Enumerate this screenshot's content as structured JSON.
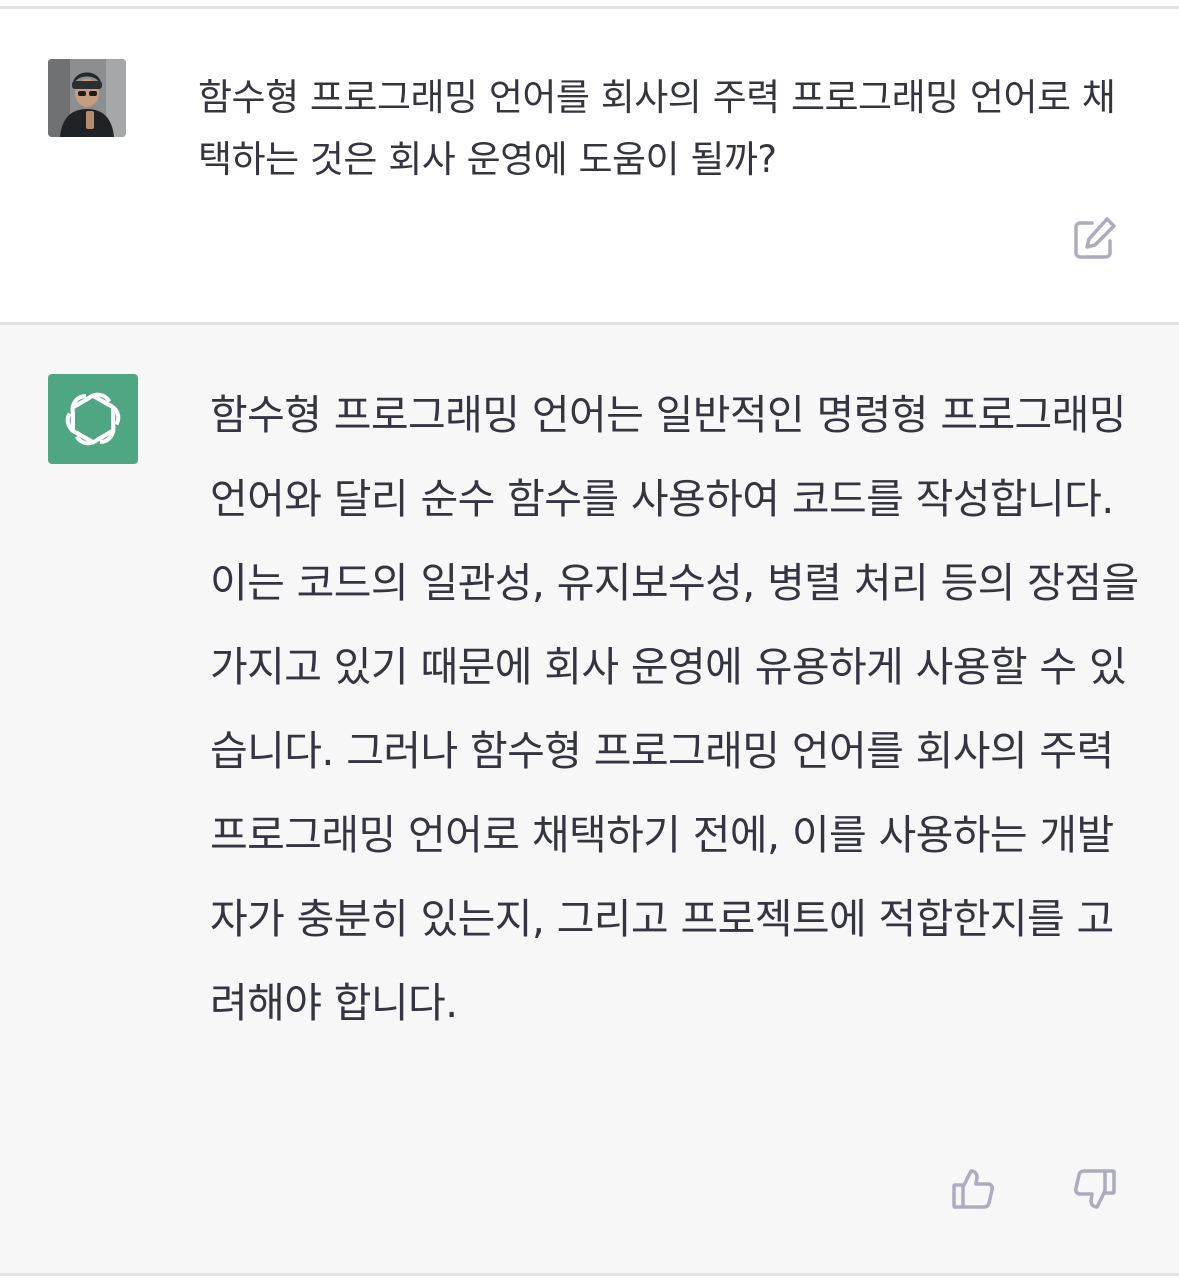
{
  "user_message": {
    "text": "함수형 프로그래밍 언어를 회사의 주력 프로그래밍 언어로 채택하는 것은 회사 운영에 도움이 될까?"
  },
  "assistant_message": {
    "text": "함수형 프로그래밍 언어는 일반적인 명령형 프로그래밍 언어와 달리 순수 함수를 사용하여 코드를 작성합니다. 이는 코드의 일관성, 유지보수성, 병렬 처리 등의 장점을 가지고 있기 때문에 회사 운영에 유용하게 사용할 수 있습니다. 그러나 함수형 프로그래밍 언어를 회사의 주력 프로그래밍 언어로 채택하기 전에, 이를 사용하는 개발자가 충분히 있는지, 그리고 프로젝트에 적합한지를 고려해야 합니다."
  },
  "icons": {
    "user_avatar": "user-avatar-photo",
    "assistant_avatar": "openai-logo-icon",
    "edit": "edit-icon",
    "thumbs_up": "thumbs-up-icon",
    "thumbs_down": "thumbs-down-icon"
  },
  "colors": {
    "assistant_avatar_bg": "#4fa683",
    "assistant_bg": "#f7f7f8",
    "text": "#343541",
    "icon": "#acacbe"
  }
}
